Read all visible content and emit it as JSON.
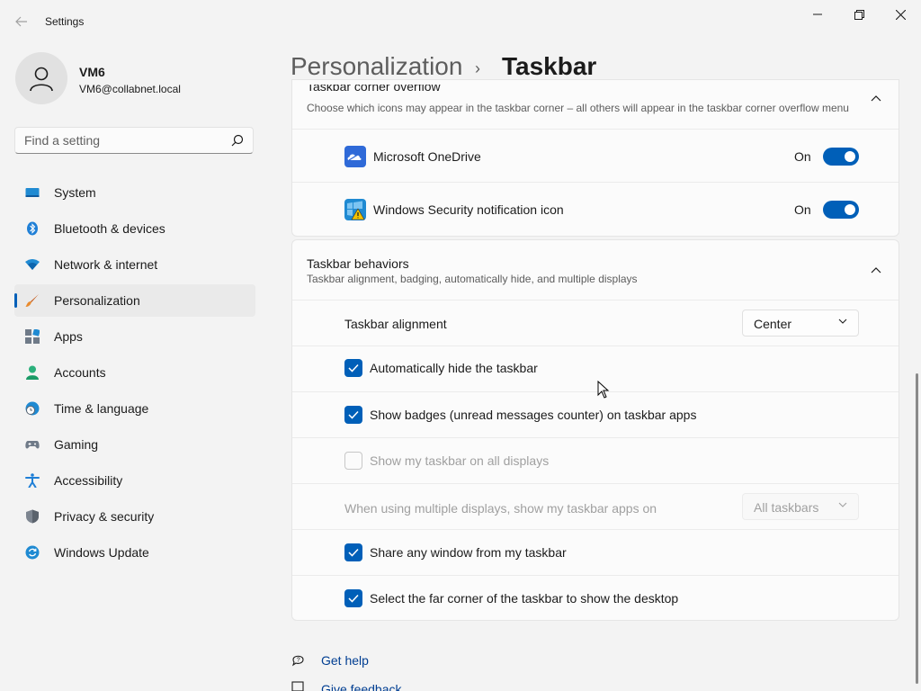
{
  "window": {
    "title": "Settings"
  },
  "user": {
    "name": "VM6",
    "email": "VM6@collabnet.local"
  },
  "search": {
    "placeholder": "Find a setting"
  },
  "nav": {
    "items": [
      {
        "label": "System",
        "icon": "system-icon"
      },
      {
        "label": "Bluetooth & devices",
        "icon": "bluetooth-icon"
      },
      {
        "label": "Network & internet",
        "icon": "wifi-icon"
      },
      {
        "label": "Personalization",
        "icon": "brush-icon",
        "active": true
      },
      {
        "label": "Apps",
        "icon": "apps-icon"
      },
      {
        "label": "Accounts",
        "icon": "accounts-icon"
      },
      {
        "label": "Time & language",
        "icon": "time-language-icon"
      },
      {
        "label": "Gaming",
        "icon": "gamepad-icon"
      },
      {
        "label": "Accessibility",
        "icon": "accessibility-icon"
      },
      {
        "label": "Privacy & security",
        "icon": "shield-icon"
      },
      {
        "label": "Windows Update",
        "icon": "update-icon"
      }
    ]
  },
  "breadcrumb": {
    "parent": "Personalization",
    "separator": "›",
    "current": "Taskbar"
  },
  "corner_overflow": {
    "title": "Taskbar corner overflow",
    "subtitle": "Choose which icons may appear in the taskbar corner – all others will appear in the taskbar corner overflow menu",
    "items": [
      {
        "label": "Microsoft OneDrive",
        "state": "On",
        "icon": "onedrive-icon"
      },
      {
        "label": "Windows Security notification icon",
        "state": "On",
        "icon": "windows-security-icon"
      }
    ]
  },
  "behaviors": {
    "title": "Taskbar behaviors",
    "subtitle": "Taskbar alignment, badging, automatically hide, and multiple displays",
    "alignment_label": "Taskbar alignment",
    "alignment_value": "Center",
    "auto_hide": "Automatically hide the taskbar",
    "badges": "Show badges (unread messages counter) on taskbar apps",
    "all_displays": "Show my taskbar on all displays",
    "multi_display_label": "When using multiple displays, show my taskbar apps on",
    "multi_display_value": "All taskbars",
    "share_window": "Share any window from my taskbar",
    "far_corner": "Select the far corner of the taskbar to show the desktop"
  },
  "footer": {
    "get_help": "Get help",
    "give_feedback": "Give feedback"
  },
  "colors": {
    "accent": "#005fb8",
    "background": "#f3f3f3",
    "card": "#fbfbfb"
  }
}
